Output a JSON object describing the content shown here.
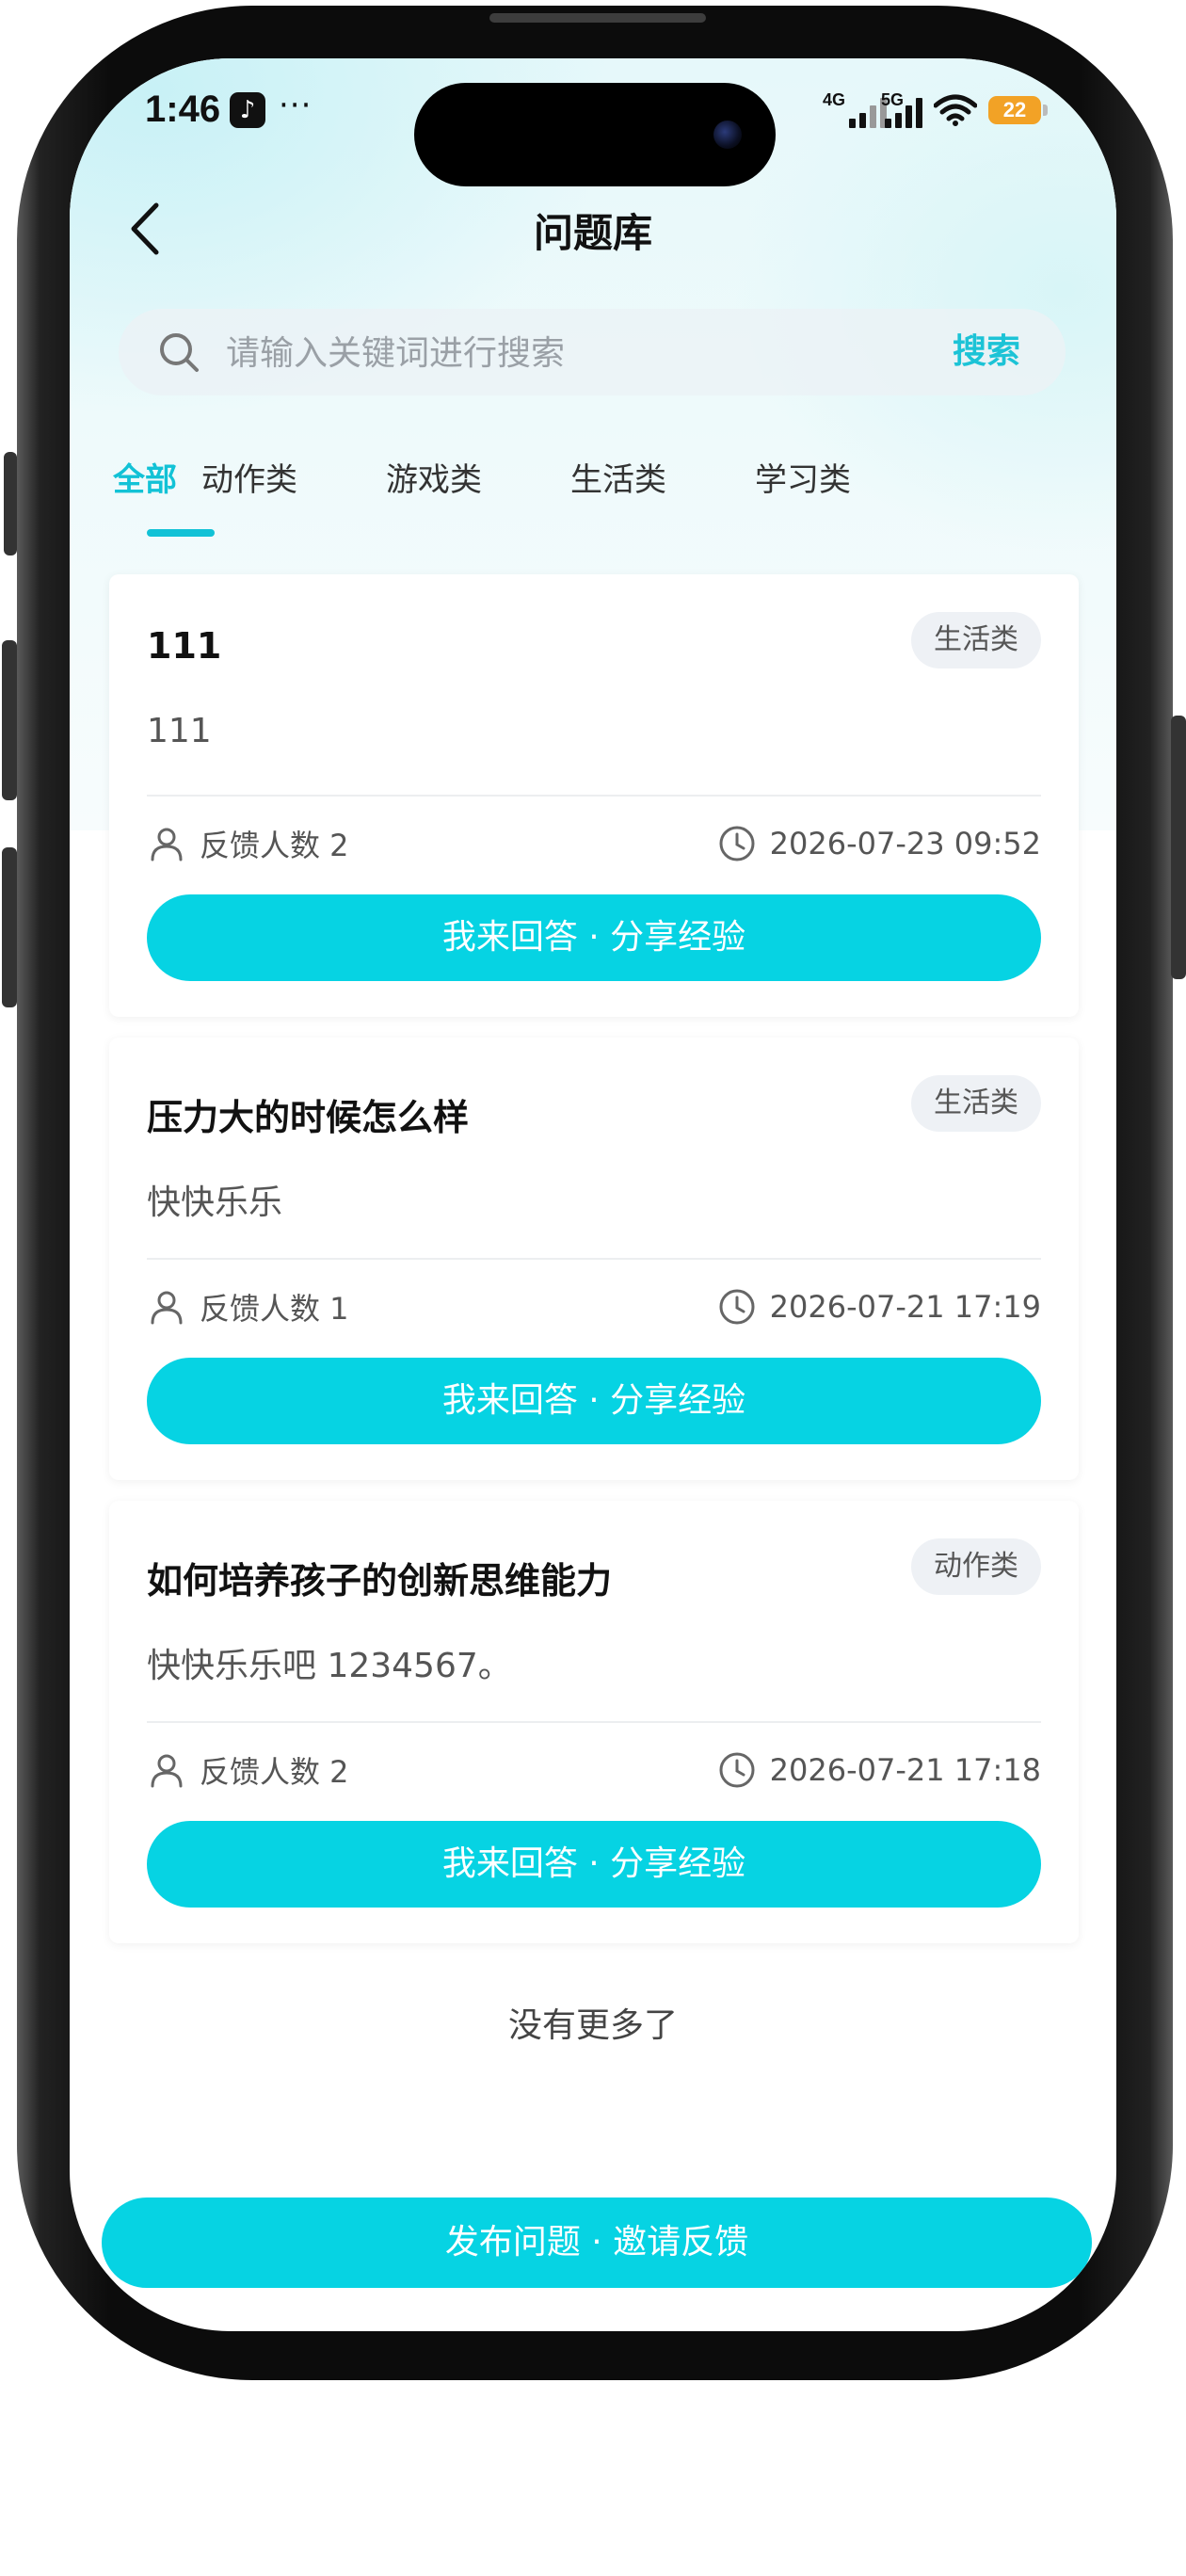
{
  "status_bar": {
    "time": "1:46",
    "app_icon": "tiktok-icon",
    "more_dots": "···",
    "net_1": "4G",
    "net_2": "5G",
    "battery": "22"
  },
  "header": {
    "title": "问题库",
    "back_icon": "chevron-left-icon"
  },
  "search": {
    "placeholder": "请输入关键词进行搜索",
    "button_label": "搜索"
  },
  "tabs": [
    {
      "label": "全部",
      "active": true
    },
    {
      "label": "动作类",
      "active": false
    },
    {
      "label": "游戏类",
      "active": false
    },
    {
      "label": "生活类",
      "active": false
    },
    {
      "label": "学习类",
      "active": false
    }
  ],
  "questions": [
    {
      "title": "111",
      "category": "生活类",
      "description": "111",
      "feedback": "反馈人数 2",
      "time": "2026-07-23 09:52",
      "button_label": "我来回答 · 分享经验"
    },
    {
      "title": "压力大的时候怎么样",
      "category": "生活类",
      "description": "快快乐乐",
      "feedback": "反馈人数 1",
      "time": "2026-07-21 17:19",
      "button_label": "我来回答 · 分享经验"
    },
    {
      "title": "如何培养孩子的创新思维能力",
      "category": "动作类",
      "description": "快快乐乐吧 1234567。",
      "feedback": "反馈人数 2",
      "time": "2026-07-21 17:18",
      "button_label": "我来回答 · 分享经验"
    }
  ],
  "list_end_text": "没有更多了",
  "footer": {
    "publish_button": "发布问题 · 邀请反馈"
  },
  "colors": {
    "accent": "#06d3e3",
    "tab_active": "#12c2d6",
    "battery": "#f2a226"
  }
}
